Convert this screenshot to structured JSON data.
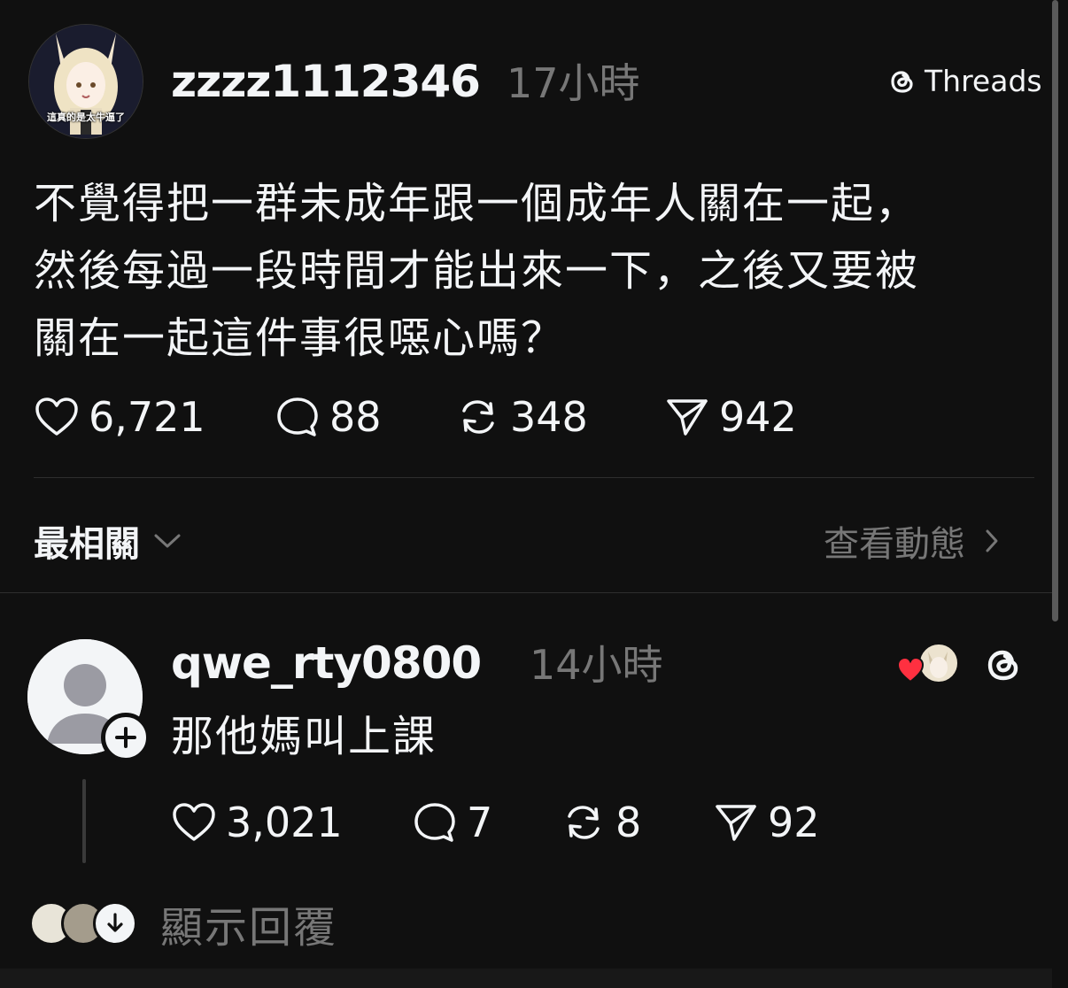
{
  "app": {
    "brand_label": "Threads"
  },
  "post": {
    "username": "zzzz1112346",
    "time": "17小時",
    "avatar_caption": "這真的是太牛逼了",
    "text_lines": [
      "不覺得把一群未成年跟一個成年人關在一起，",
      "然後每過一段時間才能出來一下，之後又要被",
      "關在一起這件事很噁心嗎？"
    ],
    "stats": {
      "likes": "6,721",
      "comments": "88",
      "reposts": "348",
      "shares": "942"
    }
  },
  "sort": {
    "label": "最相關",
    "view_activity_label": "查看動態"
  },
  "reply": {
    "username": "qwe_rty0800",
    "time": "14小時",
    "text": "那他媽叫上課",
    "stats": {
      "likes": "3,021",
      "comments": "7",
      "reposts": "8",
      "shares": "92"
    }
  },
  "show_replies": {
    "label": "顯示回覆"
  },
  "colors": {
    "background": "#101010",
    "primary_text": "#f3f5f7",
    "secondary_text": "#777777",
    "like_red": "#ff3040"
  }
}
